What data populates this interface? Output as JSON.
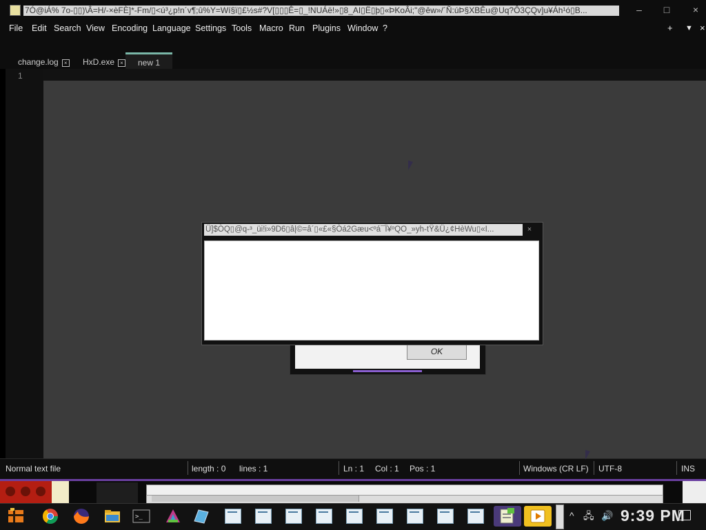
{
  "window": {
    "title": "7Ó@iÁ% 7o-▯▯)\\Â=H/-×èFÈ]*-Fm/▯<ú³¿p!n´v¶;û%Y=Wí§ï▯£½s#?V[▯▯▯Ê=▯_!NUÁë!»▯8_AI▯Ë▯þ▯«ÞKoÂi;\"@êw»/´Ñ:úÞ§XBÊu@Uq?Ô3ÇQv]u¥Áh¹ó▯B...",
    "minimize": "–",
    "maximize": "□",
    "close": "×"
  },
  "menu": {
    "items": [
      "File",
      "Edit",
      "Search",
      "View",
      "Encoding",
      "Language",
      "Settings",
      "Tools",
      "Macro",
      "Run",
      "Plugins",
      "Window",
      "?"
    ],
    "add": "+",
    "list": "▼",
    "close": "×"
  },
  "tabs": [
    {
      "label": "change.log"
    },
    {
      "label": "HxD.exe"
    },
    {
      "label": "new 1"
    }
  ],
  "tab_close": "×",
  "editor": {
    "line_number": "1",
    "content": ""
  },
  "dialog_back": {
    "ok_label": "OK"
  },
  "dialog_front": {
    "title": "Ü]$ÒQ▯@q-³_üi!i»9D6▯â|©=â´▯«£«§Òá2Gæu<ºá¯Ï¥ºQO_»yh-tŸ&Ü¿¢HèWu▯«I...",
    "close": "×"
  },
  "status": {
    "file_type": "Normal text file",
    "length": "length : 0",
    "lines": "lines : 1",
    "ln": "Ln : 1",
    "col": "Col : 1",
    "pos": "Pos : 1",
    "eol": "Windows (CR LF)",
    "encoding": "UTF-8",
    "mode": "INS"
  },
  "taskbar": {
    "clock": "9:39 PM",
    "tray_up": "^",
    "tray_network": "🖧",
    "tray_volume": "🔊"
  },
  "icons": [
    "start-icon",
    "chrome-icon",
    "firefox-icon",
    "file-explorer-icon",
    "terminal-icon",
    "paint-icon",
    "gem-icon",
    "window-icon",
    "notepad-icon",
    "media-player-icon",
    "network-icon",
    "volume-icon",
    "notification-icon"
  ],
  "colors": {
    "accent_tab": "#7ab7a8",
    "purple_accent": "#6a3fa0",
    "editor_bg": "#3b3b3b"
  }
}
